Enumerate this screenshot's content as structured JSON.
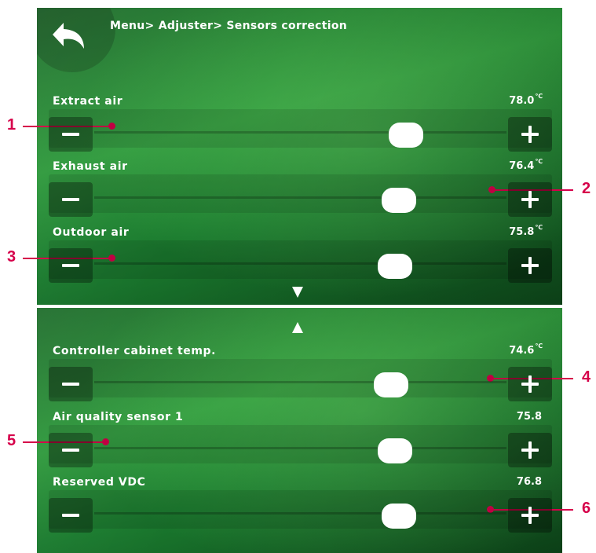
{
  "colors": {
    "callout": "#d6004a",
    "panel_green": "#2f9a3d",
    "text": "#ffffff"
  },
  "header": {
    "back_icon": "back-arrow-icon",
    "breadcrumb": "Menu> Adjuster> Sensors correction"
  },
  "rows": [
    {
      "label": "Extract air",
      "value": "78.0",
      "unit": "℃",
      "level": 0.78
    },
    {
      "label": "Exhaust air",
      "value": "76.4",
      "unit": "℃",
      "level": 0.76
    },
    {
      "label": "Outdoor air",
      "value": "75.8",
      "unit": "℃",
      "level": 0.75
    },
    {
      "label": "Controller cabinet temp.",
      "value": "74.6",
      "unit": "℃",
      "level": 0.74
    },
    {
      "label": "Air quality sensor 1",
      "value": "75.8",
      "unit": "",
      "level": 0.75
    },
    {
      "label": "Reserved VDC",
      "value": "76.8",
      "unit": "",
      "level": 0.76
    }
  ],
  "icons": {
    "decrease": "minus-icon",
    "increase": "plus-icon",
    "scroll_down": "triangle-down-icon",
    "scroll_up": "triangle-up-icon"
  },
  "callouts": [
    "1",
    "2",
    "3",
    "4",
    "5",
    "6"
  ]
}
